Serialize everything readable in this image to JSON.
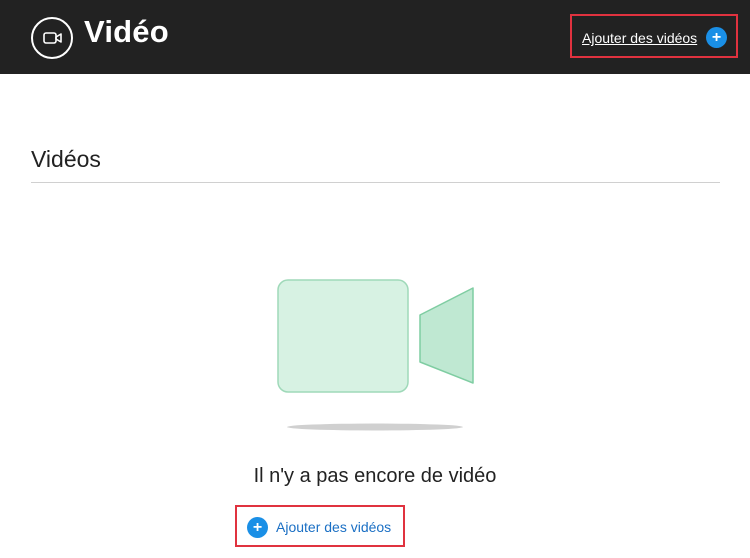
{
  "header": {
    "title": "Vidéo",
    "icon": "video-camera-icon",
    "add_button_label": "Ajouter des vidéos",
    "add_icon": "plus-circle-icon"
  },
  "section": {
    "title": "Vidéos"
  },
  "empty_state": {
    "illustration": "video-camera-illustration",
    "message": "Il n'y a pas encore de vidéo",
    "add_button_label": "Ajouter des vidéos",
    "add_icon": "plus-circle-icon"
  },
  "colors": {
    "topbar": "#222222",
    "accent_blue": "#1a8fe6",
    "highlight_red": "#e0323f",
    "illustration_green": "#bfe8d2"
  }
}
